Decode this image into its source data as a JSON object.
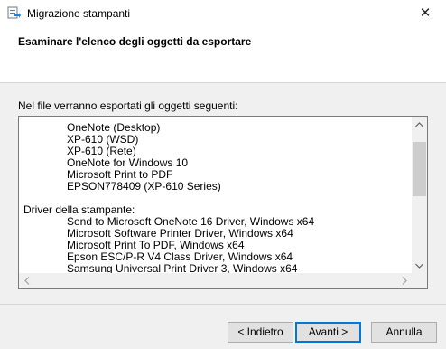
{
  "window": {
    "title": "Migrazione stampanti",
    "close_glyph": "✕"
  },
  "header": {
    "title": "Esaminare l'elenco degli oggetti da esportare"
  },
  "content": {
    "intro": "Nel file verranno esportati gli oggetti seguenti:",
    "list": {
      "printers": [
        "OneNote (Desktop)",
        "XP-610 (WSD)",
        "XP-610 (Rete)",
        "OneNote for Windows 10",
        "Microsoft Print to PDF",
        "EPSON778409 (XP-610 Series)"
      ],
      "drivers_heading": "Driver della stampante:",
      "drivers": [
        "Send to Microsoft OneNote 16 Driver, Windows x64",
        "Microsoft Software Printer Driver, Windows x64",
        "Microsoft Print To PDF, Windows x64",
        "Epson ESC/P-R V4 Class Driver, Windows x64",
        "Samsung Universal Print Driver 3, Windows x64"
      ]
    }
  },
  "buttons": {
    "back": "< Indietro",
    "next": "Avanti >",
    "cancel": "Annulla"
  },
  "icons": {
    "app": "printer-migration-icon",
    "scroll_up": "chevron-up-icon",
    "scroll_down": "chevron-down-icon",
    "scroll_left": "chevron-left-icon",
    "scroll_right": "chevron-right-icon",
    "close": "close-icon"
  },
  "colors": {
    "accent": "#0078d7",
    "window_bg": "#f0f0f0",
    "header_bg": "#ffffff"
  }
}
